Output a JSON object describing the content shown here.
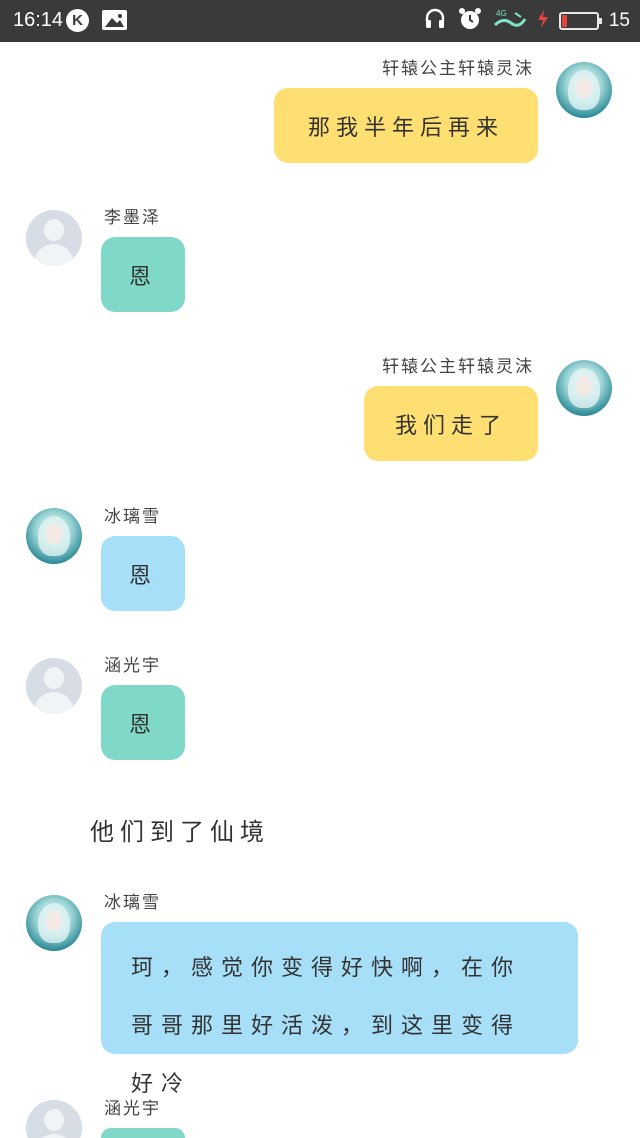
{
  "status_bar": {
    "time": "16:14",
    "k_badge": "K",
    "battery_level": "15",
    "icons": [
      "headphones-icon",
      "alarm-icon",
      "4g-signal-icon",
      "charging-icon",
      "battery-icon"
    ]
  },
  "messages": [
    {
      "sender": "轩辕公主轩辕灵沫",
      "text": "那我半年后再来",
      "side": "right",
      "bubble_color": "#ffdf72"
    },
    {
      "sender": "李墨泽",
      "text": "恩",
      "side": "left",
      "bubble_color": "#80d9c8"
    },
    {
      "sender": "轩辕公主轩辕灵沫",
      "text": "我们走了",
      "side": "right",
      "bubble_color": "#ffdf72"
    },
    {
      "sender": "冰璃雪",
      "text": "恩",
      "side": "left",
      "bubble_color": "#a6dff7"
    },
    {
      "sender": "涵光宇",
      "text": "恩",
      "side": "left",
      "bubble_color": "#80d9c8"
    },
    {
      "narration": "他们到了仙境"
    },
    {
      "sender": "冰璃雪",
      "text": "珂，感觉你变得好快啊，在你哥哥那里好活泼，到这里变得好冷",
      "side": "left",
      "bubble_color": "#a6dff7"
    },
    {
      "sender": "涵光宇",
      "text": "",
      "side": "left",
      "bubble_color": "#80d9c8"
    }
  ]
}
